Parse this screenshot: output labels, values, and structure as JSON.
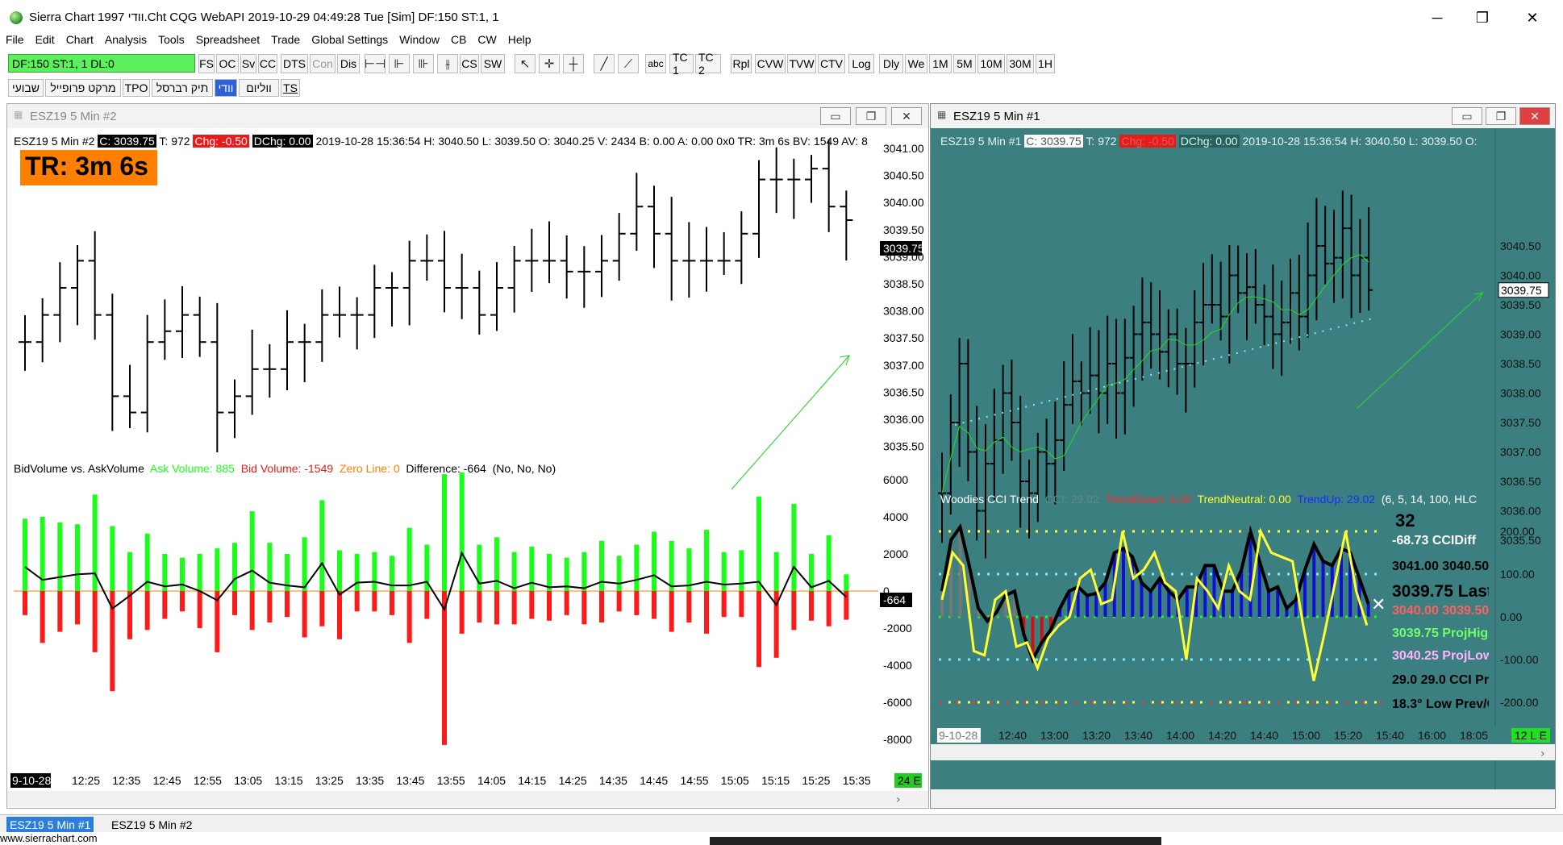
{
  "window": {
    "title": "Sierra Chart 1997 וודי.Cht  CQG WebAPI 2019-10-29  04:49:28 Tue [Sim]  DF:150  ST:1, 1",
    "minimize": "─",
    "maximize": "❐",
    "close": "✕"
  },
  "menu": [
    "File",
    "Edit",
    "Chart",
    "Analysis",
    "Tools",
    "Spreadsheet",
    "Trade",
    "Global Settings",
    "Window",
    "CB",
    "CW",
    "Help"
  ],
  "toolbar": {
    "df_status": "DF:150  ST:1, 1  DL:0",
    "buttons_a": [
      "FS",
      "OC",
      "Sv",
      "CC",
      "DTS",
      "Con",
      "Dis"
    ],
    "buttons_b": [
      "CS",
      "SW"
    ],
    "abc": "abc",
    "buttons_c": [
      "TC 1",
      "TC 2",
      "Rpl",
      "CVW",
      "TVW",
      "CTV",
      "Log",
      "Dly",
      "We",
      "1M",
      "5M",
      "10M",
      "30M",
      "1H"
    ]
  },
  "tabs": [
    "שבועי",
    "מרקט פרופייל",
    "TPO",
    "תיק רברסל",
    "וודי",
    "ווליום",
    "TS"
  ],
  "left_chart": {
    "window_title": "ESZ19  5 Min   #2",
    "info_prefix": "ESZ19  5 Min   #2",
    "close_label": "C: 3039.75",
    "trades": "T: 972",
    "chg": "Chg: -0.50",
    "dchg": "DChg: 0.00",
    "info_rest": "2019-10-28 15:36:54 H: 3040.50 L: 3039.50 O: 3040.25 V: 2434 B: 0.00 A: 0.00 0x0 TR: 3m 6s BV: 1549 AV: 8",
    "tr_box": "TR: 3m 6s",
    "price_axis": [
      "3041.00",
      "3040.50",
      "3040.00",
      "3039.50",
      "3039.00",
      "3038.50",
      "3038.00",
      "3037.50",
      "3037.00",
      "3036.50",
      "3036.00",
      "3035.50"
    ],
    "last_price": "3039.75",
    "subgraph_title": "BidVolume vs. AskVolume",
    "ask_volume": "Ask Volume: 885",
    "bid_volume": "Bid Volume: -1549",
    "zero_line": "Zero Line: 0",
    "difference": "Difference: -664",
    "flags": "(No, No, No)",
    "volume_axis": [
      "6000",
      "4000",
      "2000",
      "0",
      "-2000",
      "-4000",
      "-6000",
      "-8000"
    ],
    "diff_badge": "-664",
    "time_axis_start": "9-10-28",
    "time_axis": [
      "12:25",
      "12:35",
      "12:45",
      "12:55",
      "13:05",
      "13:15",
      "13:25",
      "13:35",
      "13:45",
      "13:55",
      "14:05",
      "14:15",
      "14:25",
      "14:35",
      "14:45",
      "14:55",
      "15:05",
      "15:15",
      "15:25",
      "15:35"
    ],
    "bar_count_badge": "24 E"
  },
  "right_chart": {
    "window_title": "ESZ19  5 Min   #1",
    "info_prefix": "ESZ19  5 Min   #1",
    "close_label": "C: 3039.75",
    "trades": "T: 972",
    "chg": "Chg: -0.50",
    "dchg": "DChg: 0.00",
    "info_rest": "2019-10-28 15:36:54 H: 3040.50 L: 3039.50 O: 3",
    "price_axis": [
      "3040.50",
      "3040.00",
      "3039.50",
      "3039.00",
      "3038.50",
      "3038.00",
      "3037.50",
      "3037.00",
      "3036.50",
      "3036.00",
      "3035.50"
    ],
    "last_price": "3039.75",
    "cci_title": "Woodies CCI Trend",
    "cci_value": "CCI: 29.02",
    "trend_down": "TrendDown: 0.00",
    "trend_neutral": "TrendNeutral: 0.00",
    "trend_up": "TrendUp: 29.02",
    "cci_params": "(6, 5, 14, 100, HLC",
    "cci_axis": [
      "200.00",
      "100.00",
      "0.00",
      "-100.00",
      "-200.00"
    ],
    "panel_count": "32",
    "cci_diff": "-68.73 CCIDiff",
    "prices_line": "3041.00 3040.50",
    "last_line": "3039.75 Last",
    "red_line": "3040.00 3039.50",
    "proj_high": "3039.75 ProjHig",
    "proj_low": "3040.25 ProjLow",
    "cci_line": "29.0   29.0 CCI Pr",
    "angle_line": "18.3° Low Prev/C",
    "time_axis_start": "9-10-28",
    "time_axis": [
      "12:40",
      "13:00",
      "13:20",
      "13:40",
      "14:00",
      "14:20",
      "14:40",
      "15:00",
      "15:20",
      "15:40",
      "16:00",
      "18:05"
    ],
    "bar_count_badge": "12 L E"
  },
  "status_tabs": [
    "ESZ19  5 Min   #1",
    "ESZ19  5 Min   #2"
  ],
  "footer_url": "www.sierrachart.com",
  "colors": {
    "ask": "#1aff1a",
    "bid": "#ff1a1a",
    "teal_bg": "#3c7f80",
    "cci_up": "#1010d0",
    "cci_down": "#d01010",
    "turbo": "#ffff33",
    "accent_orange": "#ff7f00"
  }
}
